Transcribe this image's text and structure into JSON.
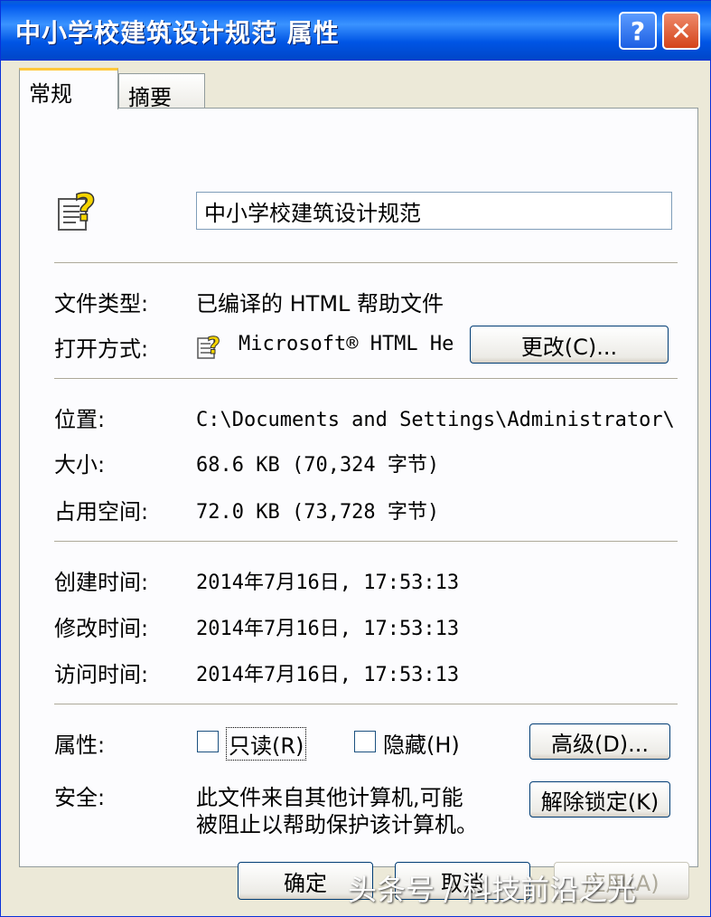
{
  "window": {
    "title": "中小学校建筑设计规范 属性",
    "help_label": "?",
    "close_label": "✕"
  },
  "tabs": [
    {
      "label": "常规",
      "active": true
    },
    {
      "label": "摘要",
      "active": false
    }
  ],
  "general": {
    "file_icon": "chm-help-file-icon",
    "name_value": "中小学校建筑设计规范",
    "file_type_label": "文件类型:",
    "file_type_value": "已编译的 HTML 帮助文件",
    "open_with_label": "打开方式:",
    "open_with_value": "Microsoft® HTML Hel",
    "change_button": "更改(C)...",
    "location_label": "位置:",
    "location_value": "C:\\Documents and Settings\\Administrator\\桌",
    "size_label": "大小:",
    "size_value": "68.6 KB (70,324 字节)",
    "size_on_disk_label": "占用空间:",
    "size_on_disk_value": "72.0 KB (73,728 字节)",
    "created_label": "创建时间:",
    "created_value": "2014年7月16日, 17:53:13",
    "modified_label": "修改时间:",
    "modified_value": "2014年7月16日, 17:53:13",
    "accessed_label": "访问时间:",
    "accessed_value": "2014年7月16日, 17:53:13",
    "attributes_label": "属性:",
    "readonly_label": "只读(R)",
    "readonly_checked": false,
    "hidden_label": "隐藏(H)",
    "hidden_checked": false,
    "advanced_button": "高级(D)...",
    "security_label": "安全:",
    "security_text_line1": "此文件来自其他计算机,可能",
    "security_text_line2": "被阻止以帮助保护该计算机。",
    "unblock_button": "解除锁定(K)"
  },
  "footer": {
    "ok_button": "确定",
    "cancel_button": "取消",
    "apply_button": "应用(A)"
  },
  "watermark": "头条号 / 科技前沿之光"
}
